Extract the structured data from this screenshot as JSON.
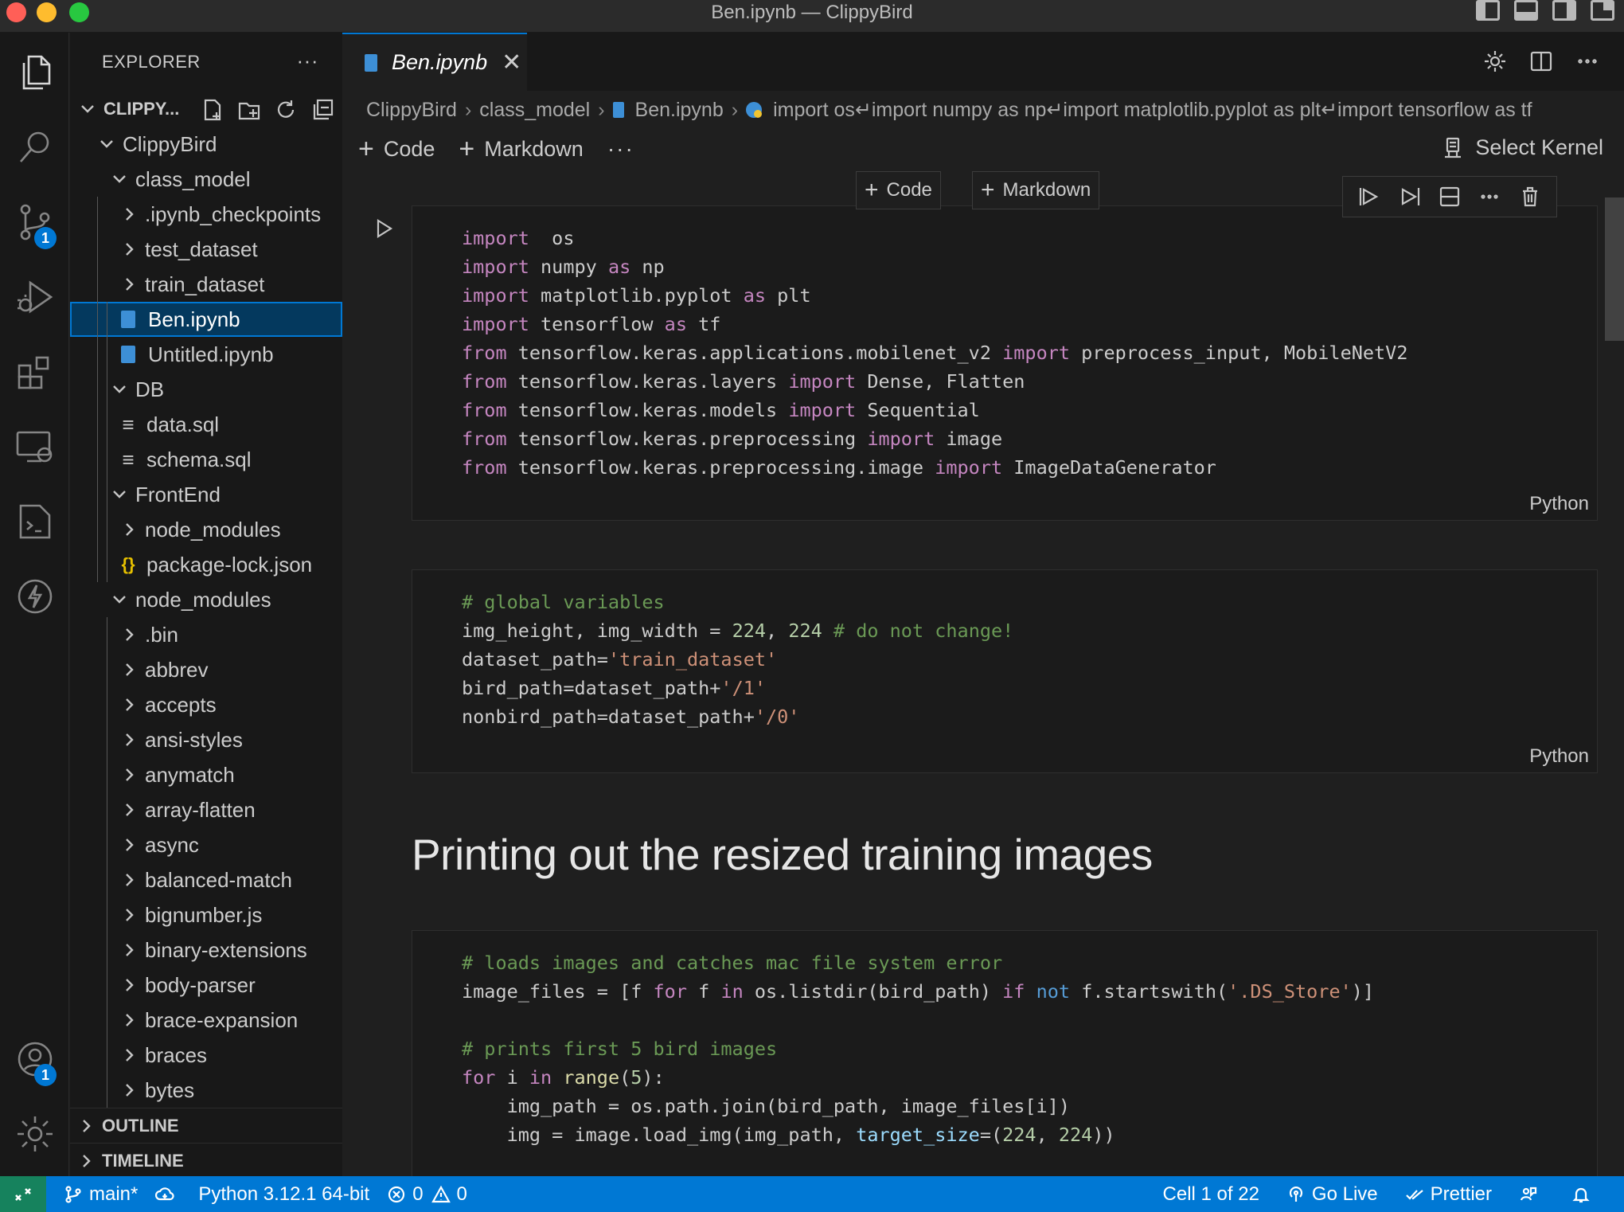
{
  "window": {
    "title": "Ben.ipynb — ClippyBird"
  },
  "activity_bar": {
    "items": [
      {
        "name": "explorer-icon"
      },
      {
        "name": "search-icon"
      },
      {
        "name": "source-control-icon",
        "badge": "1"
      },
      {
        "name": "run-debug-icon"
      },
      {
        "name": "extensions-icon"
      },
      {
        "name": "remote-explorer-icon"
      },
      {
        "name": "terminal-icon"
      },
      {
        "name": "lightning-icon"
      }
    ],
    "bottom": [
      {
        "name": "accounts-icon",
        "badge": "1"
      },
      {
        "name": "gear-icon"
      }
    ]
  },
  "sidebar": {
    "title": "EXPLORER",
    "more": "···",
    "root": "CLIPPY...",
    "tree": [
      {
        "label": "ClippyBird",
        "type": "folder",
        "open": true,
        "depth": 0
      },
      {
        "label": "class_model",
        "type": "folder",
        "open": true,
        "depth": 1
      },
      {
        "label": ".ipynb_checkpoints",
        "type": "folder",
        "open": false,
        "depth": 2
      },
      {
        "label": "test_dataset",
        "type": "folder",
        "open": false,
        "depth": 2
      },
      {
        "label": "train_dataset",
        "type": "folder",
        "open": false,
        "depth": 2
      },
      {
        "label": "Ben.ipynb",
        "type": "notebook",
        "depth": 2,
        "selected": true
      },
      {
        "label": "Untitled.ipynb",
        "type": "notebook",
        "depth": 2
      },
      {
        "label": "DB",
        "type": "folder",
        "open": true,
        "depth": 1
      },
      {
        "label": "data.sql",
        "type": "sql",
        "depth": 2
      },
      {
        "label": "schema.sql",
        "type": "sql",
        "depth": 2
      },
      {
        "label": "FrontEnd",
        "type": "folder",
        "open": true,
        "depth": 1
      },
      {
        "label": "node_modules",
        "type": "folder",
        "open": false,
        "depth": 2
      },
      {
        "label": "package-lock.json",
        "type": "json",
        "depth": 2
      },
      {
        "label": "node_modules",
        "type": "folder",
        "open": true,
        "depth": 1
      },
      {
        "label": ".bin",
        "type": "folder",
        "open": false,
        "depth": 2
      },
      {
        "label": "abbrev",
        "type": "folder",
        "open": false,
        "depth": 2
      },
      {
        "label": "accepts",
        "type": "folder",
        "open": false,
        "depth": 2
      },
      {
        "label": "ansi-styles",
        "type": "folder",
        "open": false,
        "depth": 2
      },
      {
        "label": "anymatch",
        "type": "folder",
        "open": false,
        "depth": 2
      },
      {
        "label": "array-flatten",
        "type": "folder",
        "open": false,
        "depth": 2
      },
      {
        "label": "async",
        "type": "folder",
        "open": false,
        "depth": 2
      },
      {
        "label": "balanced-match",
        "type": "folder",
        "open": false,
        "depth": 2
      },
      {
        "label": "bignumber.js",
        "type": "folder",
        "open": false,
        "depth": 2
      },
      {
        "label": "binary-extensions",
        "type": "folder",
        "open": false,
        "depth": 2
      },
      {
        "label": "body-parser",
        "type": "folder",
        "open": false,
        "depth": 2
      },
      {
        "label": "brace-expansion",
        "type": "folder",
        "open": false,
        "depth": 2
      },
      {
        "label": "braces",
        "type": "folder",
        "open": false,
        "depth": 2
      },
      {
        "label": "bytes",
        "type": "folder",
        "open": false,
        "depth": 2
      }
    ],
    "outline": "OUTLINE",
    "timeline": "TIMELINE"
  },
  "editor": {
    "tab": {
      "label": "Ben.ipynb",
      "close": "✕"
    },
    "breadcrumb": {
      "parts": [
        "ClippyBird",
        "class_model",
        "Ben.ipynb"
      ],
      "symbol": "import os↵import numpy as np↵import matplotlib.pyplot as plt↵import tensorflow as tf"
    },
    "toolbar": {
      "code": "Code",
      "markdown": "Markdown",
      "more": "···",
      "kernel": "Select Kernel"
    },
    "insert": {
      "code": "Code",
      "markdown": "Markdown"
    },
    "cells": [
      {
        "language": "Python",
        "lines": [
          [
            [
              "kw",
              "import"
            ],
            [
              "",
              "  os"
            ]
          ],
          [
            [
              "kw",
              "import"
            ],
            [
              "",
              " numpy "
            ],
            [
              "kw",
              "as"
            ],
            [
              "",
              " np"
            ]
          ],
          [
            [
              "kw",
              "import"
            ],
            [
              "",
              " matplotlib.pyplot "
            ],
            [
              "kw",
              "as"
            ],
            [
              "",
              " plt"
            ]
          ],
          [
            [
              "kw",
              "import"
            ],
            [
              "",
              " tensorflow "
            ],
            [
              "kw",
              "as"
            ],
            [
              "",
              " tf"
            ]
          ],
          [
            [
              "kw",
              "from"
            ],
            [
              "",
              " tensorflow.keras.applications.mobilenet_v2 "
            ],
            [
              "kw",
              "import"
            ],
            [
              "",
              " preprocess_input, MobileNetV2"
            ]
          ],
          [
            [
              "kw",
              "from"
            ],
            [
              "",
              " tensorflow.keras.layers "
            ],
            [
              "kw",
              "import"
            ],
            [
              "",
              " Dense, Flatten"
            ]
          ],
          [
            [
              "kw",
              "from"
            ],
            [
              "",
              " tensorflow.keras.models "
            ],
            [
              "kw",
              "import"
            ],
            [
              "",
              " Sequential"
            ]
          ],
          [
            [
              "kw",
              "from"
            ],
            [
              "",
              " tensorflow.keras.preprocessing "
            ],
            [
              "kw",
              "import"
            ],
            [
              "",
              " image"
            ]
          ],
          [
            [
              "kw",
              "from"
            ],
            [
              "",
              " tensorflow.keras.preprocessing.image "
            ],
            [
              "kw",
              "import"
            ],
            [
              "",
              " ImageDataGenerator"
            ]
          ]
        ]
      },
      {
        "language": "Python",
        "lines": [
          [
            [
              "cm",
              "# global variables"
            ]
          ],
          [
            [
              "",
              "img_height, img_width = "
            ],
            [
              "nm",
              "224"
            ],
            [
              "",
              ", "
            ],
            [
              "nm",
              "224"
            ],
            [
              "",
              " "
            ],
            [
              "cm",
              "# do not change!"
            ]
          ],
          [
            [
              "",
              "dataset_path="
            ],
            [
              "st",
              "'train_dataset'"
            ]
          ],
          [
            [
              "",
              "bird_path=dataset_path+"
            ],
            [
              "st",
              "'/1'"
            ]
          ],
          [
            [
              "",
              "nonbird_path=dataset_path+"
            ],
            [
              "st",
              "'/0'"
            ]
          ]
        ]
      },
      {
        "language": "Python",
        "lines": [
          [
            [
              "cm",
              "# loads images and catches mac file system error"
            ]
          ],
          [
            [
              "",
              "image_files = [f "
            ],
            [
              "kw",
              "for"
            ],
            [
              "",
              " f "
            ],
            [
              "kw",
              "in"
            ],
            [
              "",
              " os.listdir(bird_path) "
            ],
            [
              "kw",
              "if"
            ],
            [
              "",
              " "
            ],
            [
              "kb",
              "not"
            ],
            [
              "",
              " f.startswith("
            ],
            [
              "st",
              "'.DS_Store'"
            ],
            [
              "",
              ")]"
            ]
          ],
          [
            [
              "",
              ""
            ]
          ],
          [
            [
              "cm",
              "# prints first 5 bird images"
            ]
          ],
          [
            [
              "kw",
              "for"
            ],
            [
              "",
              " i "
            ],
            [
              "kw",
              "in"
            ],
            [
              "",
              " "
            ],
            [
              "fn",
              "range"
            ],
            [
              "",
              "("
            ],
            [
              "nm",
              "5"
            ],
            [
              "",
              "):"
            ]
          ],
          [
            [
              "",
              "    img_path = os.path.join(bird_path, image_files[i])"
            ]
          ],
          [
            [
              "",
              "    img = image.load_img(img_path, "
            ],
            [
              "pm",
              "target_size"
            ],
            [
              "",
              "=("
            ],
            [
              "nm",
              "224"
            ],
            [
              "",
              ", "
            ],
            [
              "nm",
              "224"
            ],
            [
              "",
              "))"
            ]
          ]
        ]
      }
    ],
    "markdown_heading": "Printing out the resized training images"
  },
  "statusbar": {
    "branch": "main*",
    "python": "Python 3.12.1 64-bit",
    "errors": "0",
    "warnings": "0",
    "cell": "Cell 1 of 22",
    "golive": "Go Live",
    "prettier": "Prettier"
  },
  "colors": {
    "accent": "#0078d4",
    "remote": "#16825d",
    "keyword": "#c586c0",
    "comment": "#6a9955",
    "string": "#ce9178",
    "number": "#b5cea8"
  }
}
